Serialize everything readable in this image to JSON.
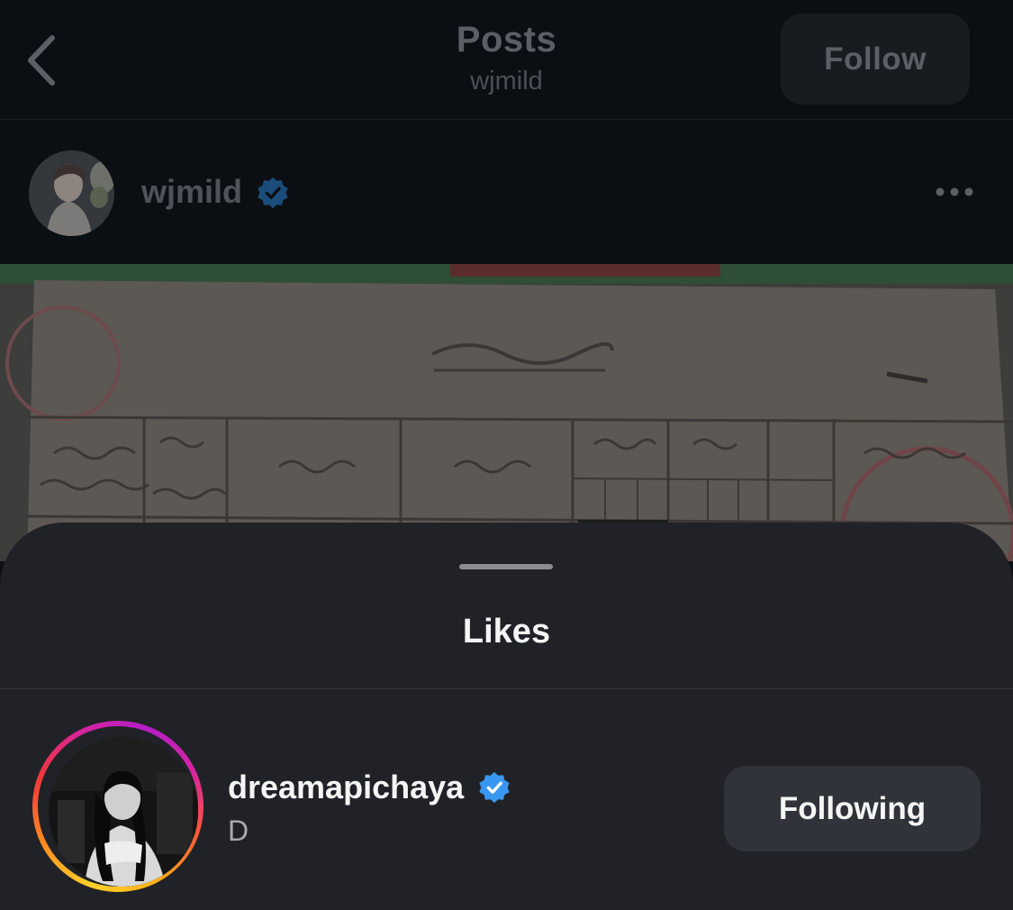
{
  "header": {
    "title": "Posts",
    "subtitle": "wjmild",
    "back_icon": "chevron-left-icon",
    "follow_label": "Follow"
  },
  "post": {
    "username": "wjmild",
    "verified": true,
    "more_icon": "more-horizontal-icon"
  },
  "likes_sheet": {
    "title": "Likes",
    "users": [
      {
        "username": "dreamapichaya",
        "full_name": "D",
        "verified": true,
        "has_story": true,
        "button_label": "Following"
      }
    ]
  },
  "colors": {
    "background": "#0b0f13",
    "sheet": "#212227",
    "verified_badge": "#3897f0",
    "following_button": "#30333a"
  }
}
